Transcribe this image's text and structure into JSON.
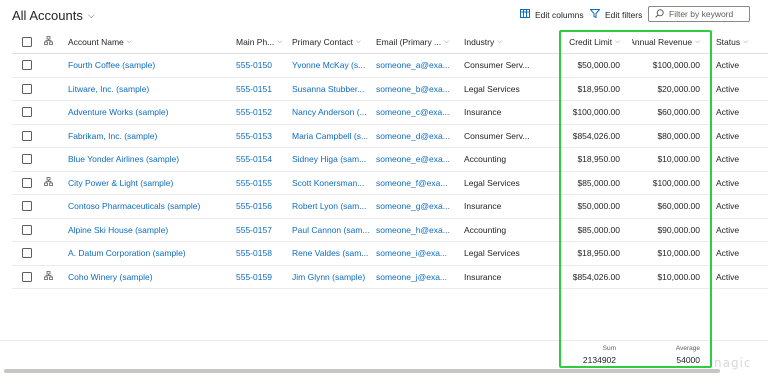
{
  "header": {
    "title": "All Accounts",
    "edit_columns": "Edit columns",
    "edit_filters": "Edit filters",
    "search_placeholder": "Filter by keyword"
  },
  "columns": {
    "name": "Account Name",
    "phone": "Main Ph...",
    "contact": "Primary Contact",
    "email": "Email (Primary ...",
    "industry": "Industry",
    "credit_limit": "Credit Limit",
    "annual_revenue": "Annual Revenue",
    "status": "Status"
  },
  "rows": [
    {
      "name": "Fourth Coffee (sample)",
      "phone": "555-0150",
      "contact": "Yvonne McKay (s...",
      "email": "someone_a@exa...",
      "industry": "Consumer Serv...",
      "credit_limit": "$50,000.00",
      "annual_revenue": "$100,000.00",
      "status": "Active",
      "hierarchy": false
    },
    {
      "name": "Litware, Inc. (sample)",
      "phone": "555-0151",
      "contact": "Susanna Stubber...",
      "email": "someone_b@exa...",
      "industry": "Legal Services",
      "credit_limit": "$18,950.00",
      "annual_revenue": "$20,000.00",
      "status": "Active",
      "hierarchy": false
    },
    {
      "name": "Adventure Works (sample)",
      "phone": "555-0152",
      "contact": "Nancy Anderson (...",
      "email": "someone_c@exa...",
      "industry": "Insurance",
      "credit_limit": "$100,000.00",
      "annual_revenue": "$60,000.00",
      "status": "Active",
      "hierarchy": false
    },
    {
      "name": "Fabrikam, Inc. (sample)",
      "phone": "555-0153",
      "contact": "Maria Campbell (s...",
      "email": "someone_d@exa...",
      "industry": "Consumer Serv...",
      "credit_limit": "$854,026.00",
      "annual_revenue": "$80,000.00",
      "status": "Active",
      "hierarchy": false
    },
    {
      "name": "Blue Yonder Airlines (sample)",
      "phone": "555-0154",
      "contact": "Sidney Higa (sam...",
      "email": "someone_e@exa...",
      "industry": "Accounting",
      "credit_limit": "$18,950.00",
      "annual_revenue": "$10,000.00",
      "status": "Active",
      "hierarchy": false
    },
    {
      "name": "City Power & Light (sample)",
      "phone": "555-0155",
      "contact": "Scott Konersman...",
      "email": "someone_f@exa...",
      "industry": "Legal Services",
      "credit_limit": "$85,000.00",
      "annual_revenue": "$100,000.00",
      "status": "Active",
      "hierarchy": true
    },
    {
      "name": "Contoso Pharmaceuticals (sample)",
      "phone": "555-0156",
      "contact": "Robert Lyon (sam...",
      "email": "someone_g@exa...",
      "industry": "Insurance",
      "credit_limit": "$50,000.00",
      "annual_revenue": "$60,000.00",
      "status": "Active",
      "hierarchy": false
    },
    {
      "name": "Alpine Ski House (sample)",
      "phone": "555-0157",
      "contact": "Paul Cannon (sam...",
      "email": "someone_h@exa...",
      "industry": "Accounting",
      "credit_limit": "$85,000.00",
      "annual_revenue": "$90,000.00",
      "status": "Active",
      "hierarchy": false
    },
    {
      "name": "A. Datum Corporation (sample)",
      "phone": "555-0158",
      "contact": "Rene Valdes (sam...",
      "email": "someone_i@exa...",
      "industry": "Legal Services",
      "credit_limit": "$18,950.00",
      "annual_revenue": "$10,000.00",
      "status": "Active",
      "hierarchy": false
    },
    {
      "name": "Coho Winery (sample)",
      "phone": "555-0159",
      "contact": "Jim Glynn (sample)",
      "email": "someone_j@exa...",
      "industry": "Insurance",
      "credit_limit": "$854,026.00",
      "annual_revenue": "$10,000.00",
      "status": "Active",
      "hierarchy": true
    }
  ],
  "footer": {
    "sum_label": "Sum",
    "sum_value": "2134902",
    "avg_label": "Average",
    "avg_value": "54000"
  },
  "watermark": "nagic",
  "colors": {
    "link": "#0f6cbd",
    "highlight": "#2ecc40"
  },
  "icons": {
    "edit_columns": "columns-icon",
    "edit_filters": "filter-icon",
    "search": "search-icon",
    "hierarchy": "hierarchy-icon"
  }
}
